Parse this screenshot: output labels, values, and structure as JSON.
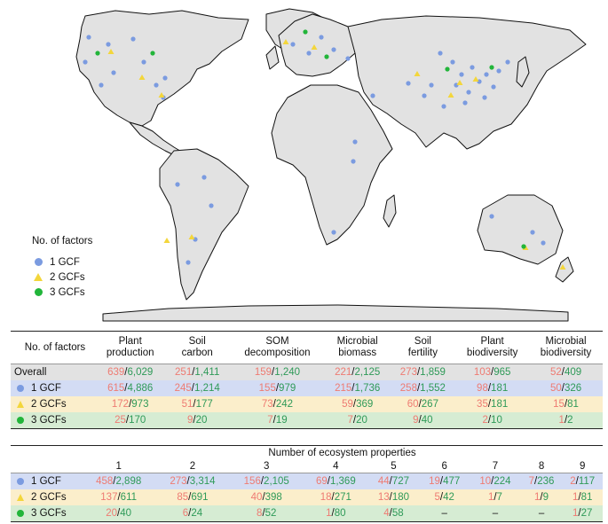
{
  "legend": {
    "title": "No. of factors",
    "items": [
      {
        "label": "1 GCF",
        "marker": "circle",
        "color": "#7b9be0"
      },
      {
        "label": "2 GCFs",
        "marker": "triangle",
        "color": "#f3d63b"
      },
      {
        "label": "3 GCFs",
        "marker": "circle",
        "color": "#22b53a"
      }
    ]
  },
  "colors": {
    "first_value": "#ee7b72",
    "second_value": "#2f9a58",
    "land": "#e2e2e2",
    "border": "#111111"
  },
  "table1": {
    "row_header": "No. of factors",
    "columns": [
      [
        "Plant",
        "production"
      ],
      [
        "Soil",
        "carbon"
      ],
      [
        "SOM",
        "decomposition"
      ],
      [
        "Microbial",
        "biomass"
      ],
      [
        "Soil",
        "fertility"
      ],
      [
        "Plant",
        "biodiversity"
      ],
      [
        "Microbial",
        "biodiversity"
      ]
    ],
    "rows": [
      {
        "label": "Overall",
        "icon": "",
        "cells": [
          [
            "639",
            "6,029"
          ],
          [
            "251",
            "1,411"
          ],
          [
            "159",
            "1,240"
          ],
          [
            "221",
            "2,125"
          ],
          [
            "273",
            "1,859"
          ],
          [
            "103",
            "965"
          ],
          [
            "52",
            "409"
          ]
        ]
      },
      {
        "label": "1 GCF",
        "icon": "circle-blue",
        "cells": [
          [
            "615",
            "4,886"
          ],
          [
            "245",
            "1,214"
          ],
          [
            "155",
            "979"
          ],
          [
            "215",
            "1,736"
          ],
          [
            "258",
            "1,552"
          ],
          [
            "98",
            "181"
          ],
          [
            "50",
            "326"
          ]
        ]
      },
      {
        "label": "2 GCFs",
        "icon": "triangle-yellow",
        "cells": [
          [
            "172",
            "973"
          ],
          [
            "51",
            "177"
          ],
          [
            "73",
            "242"
          ],
          [
            "59",
            "369"
          ],
          [
            "60",
            "267"
          ],
          [
            "35",
            "181"
          ],
          [
            "15",
            "81"
          ]
        ]
      },
      {
        "label": "3 GCFs",
        "icon": "circle-green",
        "cells": [
          [
            "25",
            "170"
          ],
          [
            "9",
            "20"
          ],
          [
            "7",
            "19"
          ],
          [
            "7",
            "20"
          ],
          [
            "9",
            "40"
          ],
          [
            "2",
            "10"
          ],
          [
            "1",
            "2"
          ]
        ]
      }
    ]
  },
  "table2": {
    "title": "Number of ecosystem properties",
    "columns": [
      "1",
      "2",
      "3",
      "4",
      "5",
      "6",
      "7",
      "8",
      "9"
    ],
    "rows": [
      {
        "label": "1 GCF",
        "icon": "circle-blue",
        "cells": [
          [
            "458",
            "2,898"
          ],
          [
            "273",
            "3,314"
          ],
          [
            "156",
            "2,105"
          ],
          [
            "69",
            "1,369"
          ],
          [
            "44",
            "727"
          ],
          [
            "19",
            "477"
          ],
          [
            "10",
            "224"
          ],
          [
            "7",
            "236"
          ],
          [
            "2",
            "117"
          ]
        ]
      },
      {
        "label": "2 GCFs",
        "icon": "triangle-yellow",
        "cells": [
          [
            "137",
            "611"
          ],
          [
            "85",
            "691"
          ],
          [
            "40",
            "398"
          ],
          [
            "18",
            "271"
          ],
          [
            "13",
            "180"
          ],
          [
            "5",
            "42"
          ],
          [
            "1",
            "7"
          ],
          [
            "1",
            "9"
          ],
          [
            "1",
            "81"
          ]
        ]
      },
      {
        "label": "3 GCFs",
        "icon": "circle-green",
        "cells": [
          [
            "20",
            "40"
          ],
          [
            "6",
            "24"
          ],
          [
            "8",
            "52"
          ],
          [
            "1",
            "80"
          ],
          [
            "4",
            "58"
          ],
          [
            "–",
            ""
          ],
          [
            "–",
            ""
          ],
          [
            "–",
            ""
          ],
          [
            "1",
            "27"
          ]
        ]
      }
    ]
  }
}
